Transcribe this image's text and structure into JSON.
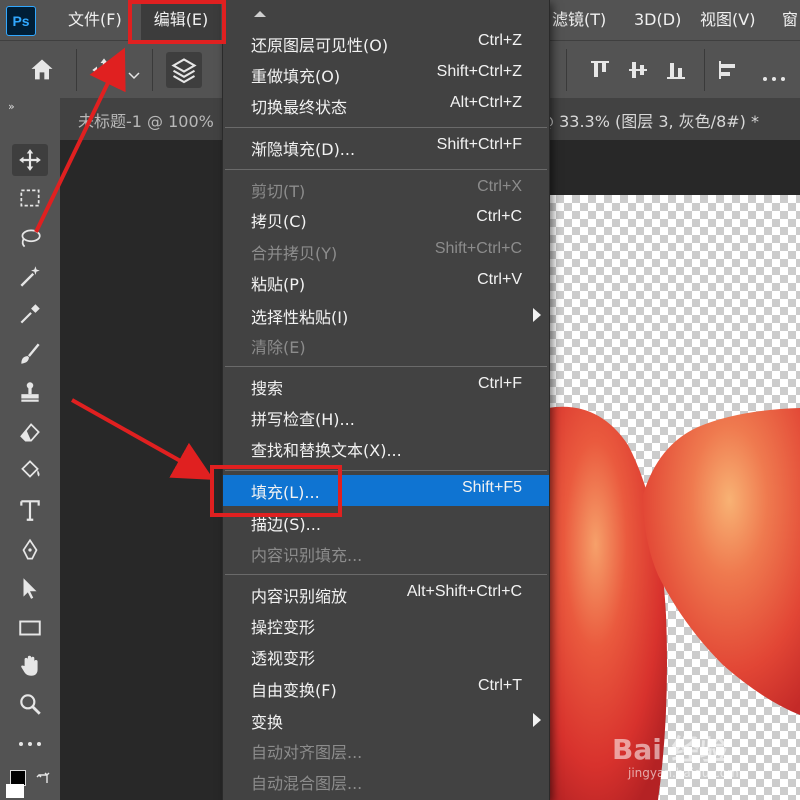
{
  "app": {
    "logo": "Ps"
  },
  "menubar": {
    "items": [
      "文件(F)",
      "编辑(E)",
      "滤镜(T)",
      "3D(D)",
      "视图(V)",
      "窗"
    ]
  },
  "tabs": {
    "tab1": "未标题-1 @ 100%",
    "tab2": "@ 33.3% (图层 3, 灰色/8#) *"
  },
  "edit_menu": {
    "items": [
      {
        "label": "还原图层可见性(O)",
        "shortcut": "Ctrl+Z",
        "enabled": true
      },
      {
        "label": "重做填充(O)",
        "shortcut": "Shift+Ctrl+Z",
        "enabled": true
      },
      {
        "label": "切换最终状态",
        "shortcut": "Alt+Ctrl+Z",
        "enabled": true
      },
      {
        "label": "渐隐填充(D)...",
        "shortcut": "Shift+Ctrl+F",
        "enabled": true
      },
      {
        "label": "剪切(T)",
        "shortcut": "Ctrl+X",
        "enabled": false
      },
      {
        "label": "拷贝(C)",
        "shortcut": "Ctrl+C",
        "enabled": true
      },
      {
        "label": "合并拷贝(Y)",
        "shortcut": "Shift+Ctrl+C",
        "enabled": false
      },
      {
        "label": "粘贴(P)",
        "shortcut": "Ctrl+V",
        "enabled": true
      },
      {
        "label": "选择性粘贴(I)",
        "shortcut": "",
        "enabled": true,
        "submenu": true
      },
      {
        "label": "清除(E)",
        "shortcut": "",
        "enabled": false
      },
      {
        "label": "搜索",
        "shortcut": "Ctrl+F",
        "enabled": true
      },
      {
        "label": "拼写检查(H)...",
        "shortcut": "",
        "enabled": true
      },
      {
        "label": "查找和替换文本(X)...",
        "shortcut": "",
        "enabled": true
      },
      {
        "label": "填充(L)...",
        "shortcut": "Shift+F5",
        "enabled": true,
        "selected": true
      },
      {
        "label": "描边(S)...",
        "shortcut": "",
        "enabled": true
      },
      {
        "label": "内容识别填充...",
        "shortcut": "",
        "enabled": false
      },
      {
        "label": "内容识别缩放",
        "shortcut": "Alt+Shift+Ctrl+C",
        "enabled": true
      },
      {
        "label": "操控变形",
        "shortcut": "",
        "enabled": true
      },
      {
        "label": "透视变形",
        "shortcut": "",
        "enabled": true
      },
      {
        "label": "自由变换(F)",
        "shortcut": "Ctrl+T",
        "enabled": true
      },
      {
        "label": "变换",
        "shortcut": "",
        "enabled": true,
        "submenu": true
      },
      {
        "label": "自动对齐图层...",
        "shortcut": "",
        "enabled": false
      },
      {
        "label": "自动混合图层...",
        "shortcut": "",
        "enabled": false
      }
    ]
  },
  "watermark": {
    "text": "Bai 经验",
    "sub": "jingyan.baidu.com"
  },
  "colors": {
    "menu_bg": "#424242",
    "selection": "#0f74d2",
    "annotation": "#e02020"
  }
}
